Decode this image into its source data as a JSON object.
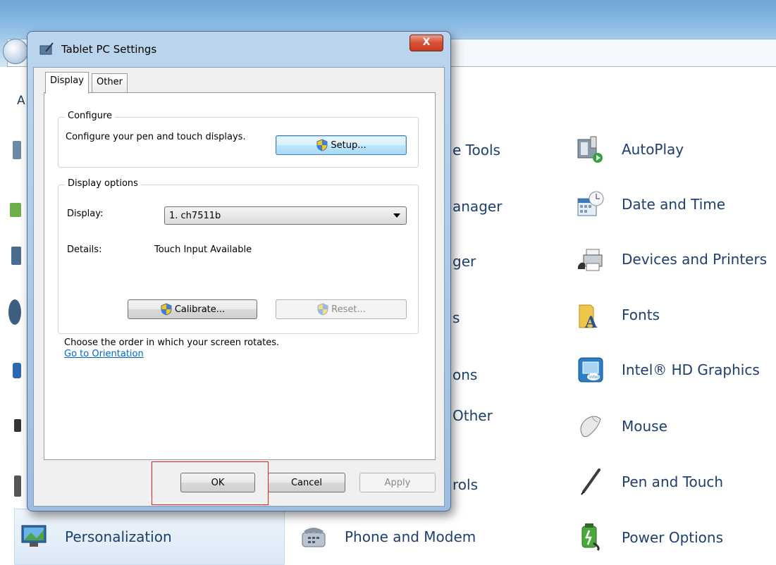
{
  "dialog": {
    "title": "Tablet PC Settings",
    "close_label": "X",
    "tabs": [
      {
        "label": "Display",
        "active": true
      },
      {
        "label": "Other",
        "active": false
      }
    ],
    "configure": {
      "legend": "Configure",
      "text": "Configure your pen and touch displays.",
      "setup_button": "Setup..."
    },
    "display_options": {
      "legend": "Display options",
      "display_label": "Display:",
      "display_value": "1. ch7511b",
      "details_label": "Details:",
      "details_value": "Touch Input Available",
      "calibrate_button": "Calibrate...",
      "reset_button": "Reset..."
    },
    "rotation_text": "Choose the order in which your screen rotates.",
    "orientation_link": "Go to Orientation",
    "ok_button": "OK",
    "cancel_button": "Cancel",
    "apply_button": "Apply"
  },
  "control_panel": {
    "header_partial": "A",
    "partial_items": [
      "e Tools",
      "anager",
      "ger",
      "s",
      "ons",
      "Other",
      "rols"
    ],
    "items": [
      {
        "label": "AutoPlay",
        "icon": "autoplay-icon"
      },
      {
        "label": "Date and Time",
        "icon": "date-time-icon"
      },
      {
        "label": "Devices and Printers",
        "icon": "devices-printers-icon"
      },
      {
        "label": "Fonts",
        "icon": "fonts-icon"
      },
      {
        "label": "Intel® HD Graphics",
        "icon": "intel-graphics-icon"
      },
      {
        "label": "Mouse",
        "icon": "mouse-icon"
      },
      {
        "label": "Pen and Touch",
        "icon": "pen-touch-icon"
      },
      {
        "label": "Power Options",
        "icon": "power-options-icon"
      }
    ],
    "bottom_items": [
      {
        "label": "Personalization",
        "icon": "personalization-icon"
      },
      {
        "label": "Phone and Modem",
        "icon": "phone-modem-icon"
      }
    ]
  },
  "colors": {
    "accent_link": "#0066cc",
    "item_text": "#1d3f6e",
    "highlight_box": "#e0201b"
  }
}
